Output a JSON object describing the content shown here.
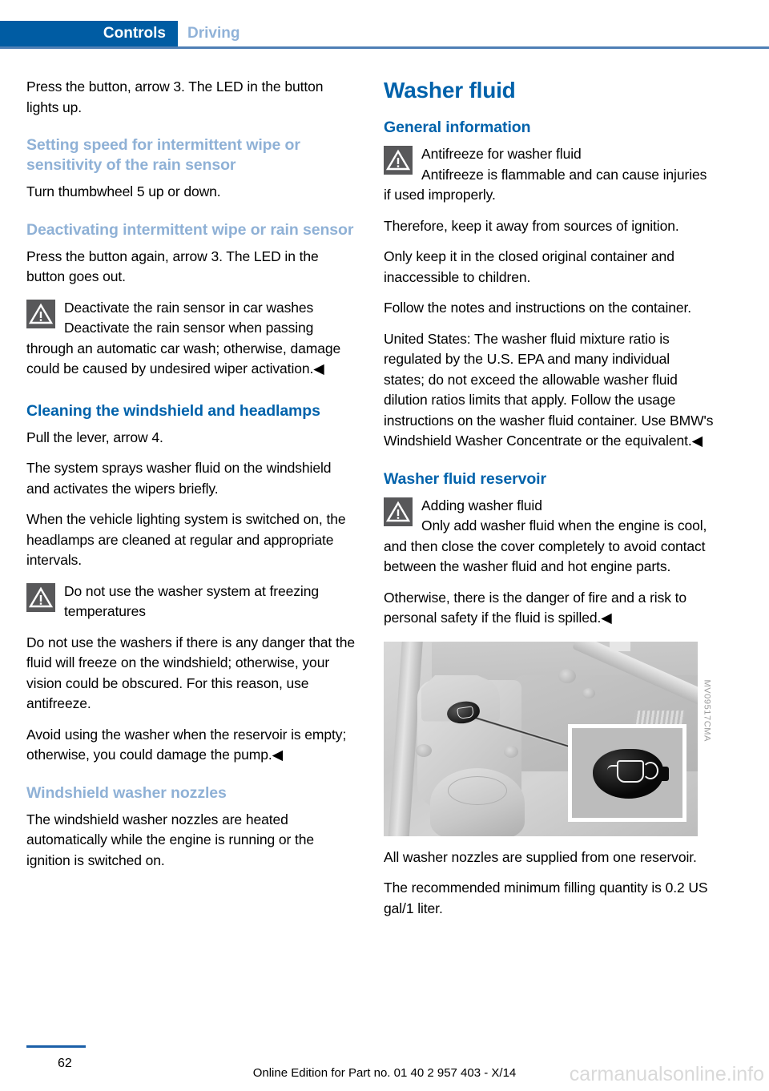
{
  "header": {
    "active_tab": "Controls",
    "inactive_tab": "Driving"
  },
  "left_column": {
    "p1": "Press the button, arrow 3. The LED in the button lights up.",
    "h1": "Setting speed for intermittent wipe or sensitivity of the rain sensor",
    "p2": "Turn thumbwheel 5 up or down.",
    "h2": "Deactivating intermittent wipe or rain sensor",
    "p3": "Press the button again, arrow 3. The LED in the button goes out.",
    "warning1": {
      "icon": "warning-triangle-icon",
      "title": "Deactivate the rain sensor in car washes",
      "body": "Deactivate the rain sensor when passing through an automatic car wash; otherwise, damage could be caused by undesired wiper activation.◀"
    },
    "h3": "Cleaning the windshield and headlamps",
    "p4": "Pull the lever, arrow 4.",
    "p5": "The system sprays washer fluid on the windshield and activates the wipers briefly.",
    "p6": "When the vehicle lighting system is switched on, the headlamps are cleaned at regular and appropriate intervals.",
    "warning2": {
      "icon": "warning-triangle-icon",
      "title": "Do not use the washer system at freezing temperatures",
      "body1": "Do not use the washers if there is any danger that the fluid will freeze on the windshield; otherwise, your vision could be obscured. For this reason, use antifreeze.",
      "body2": "Avoid using the washer when the reservoir is empty; otherwise, you could damage the pump.◀"
    },
    "h4": "Windshield washer nozzles",
    "p7": "The windshield washer nozzles are heated automatically while the engine is running or the ignition is switched on."
  },
  "right_column": {
    "title": "Washer fluid",
    "h1": "General information",
    "warning1": {
      "icon": "warning-triangle-icon",
      "title": "Antifreeze for washer fluid",
      "body": "Antifreeze is flammable and can cause injuries if used improperly."
    },
    "p1": "Therefore, keep it away from sources of ignition.",
    "p2": "Only keep it in the closed original container and inaccessible to children.",
    "p3": "Follow the notes and instructions on the container.",
    "p4": "United States: The washer fluid mixture ratio is regulated by the U.S. EPA and many individual states; do not exceed the allowable washer fluid dilution ratios limits that apply. Follow the usage instructions on the washer fluid container. Use BMW's Windshield Washer Concentrate or the equivalent.◀",
    "h2": "Washer fluid reservoir",
    "warning2": {
      "icon": "warning-triangle-icon",
      "title": "Adding washer fluid",
      "body1": "Only add washer fluid when the engine is cool, and then close the cover completely to avoid contact between the washer fluid and hot engine parts.",
      "body2": "Otherwise, there is the danger of fire and a risk to personal safety if the fluid is spilled.◀"
    },
    "figure": {
      "code": "MV09517CMA"
    },
    "p5": "All washer nozzles are supplied from one reservoir.",
    "p6": "The recommended minimum filling quantity is 0.2 US gal/1 liter."
  },
  "footer": {
    "page_number": "62",
    "edition": "Online Edition for Part no. 01 40 2 957 403 - X/14",
    "watermark": "carmanualsonline.info"
  },
  "colors": {
    "tab_blue": "#005ca3",
    "tab_inactive_blue": "#90b2d8",
    "heading_blue": "#0062ab",
    "heading_light_blue": "#8fb1d6",
    "rule_blue": "#4e7fb5",
    "warning_icon_gray": "#58585a"
  }
}
